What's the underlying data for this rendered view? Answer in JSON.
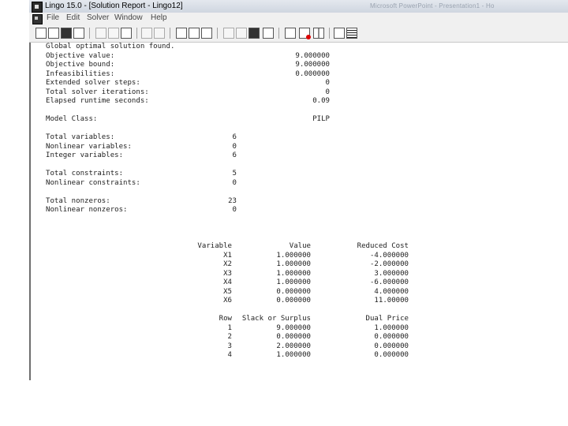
{
  "window": {
    "title": "Lingo 15.0 - [Solution Report - Lingo12]",
    "background_app": "Microsoft PowerPoint - Presentation1 - Ho"
  },
  "menu": [
    "File",
    "Edit",
    "Solver",
    "Window",
    "Help"
  ],
  "toolbar_icons": [
    "new-icon",
    "open-icon",
    "save-icon",
    "print-icon",
    "cut-icon",
    "copy-icon",
    "paste-icon",
    "undo-icon",
    "redo-icon",
    "find-icon",
    "goto-line-icon",
    "match-paren-icon",
    "solve-icon",
    "solution-icon",
    "matrix-picture-icon",
    "options-icon",
    "send-to-back-icon",
    "close-all-icon",
    "tile-icon",
    "help-icon",
    "context-help-icon"
  ],
  "report": {
    "header": "Global optimal solution found.",
    "summary": [
      {
        "label": "Objective value:",
        "value": "9.000000"
      },
      {
        "label": "Objective bound:",
        "value": "9.000000"
      },
      {
        "label": "Infeasibilities:",
        "value": "0.000000"
      },
      {
        "label": "Extended solver steps:",
        "value": "0"
      },
      {
        "label": "Total solver iterations:",
        "value": "0"
      },
      {
        "label": "Elapsed runtime seconds:",
        "value": "0.09"
      }
    ],
    "model_class": {
      "label": "Model Class:",
      "value": "PILP"
    },
    "variables": [
      {
        "label": "Total variables:",
        "value": "6"
      },
      {
        "label": "Nonlinear variables:",
        "value": "0"
      },
      {
        "label": "Integer variables:",
        "value": "6"
      }
    ],
    "constraints": [
      {
        "label": "Total constraints:",
        "value": "5"
      },
      {
        "label": "Nonlinear constraints:",
        "value": "0"
      }
    ],
    "nonzeros": [
      {
        "label": "Total nonzeros:",
        "value": "23"
      },
      {
        "label": "Nonlinear nonzeros:",
        "value": "0"
      }
    ],
    "var_table": {
      "headers": [
        "Variable",
        "Value",
        "Reduced Cost"
      ],
      "rows": [
        [
          "X1",
          "1.000000",
          "-4.000000"
        ],
        [
          "X2",
          "1.000000",
          "-2.000000"
        ],
        [
          "X3",
          "1.000000",
          "3.000000"
        ],
        [
          "X4",
          "1.000000",
          "-6.000000"
        ],
        [
          "X5",
          "0.000000",
          "4.000000"
        ],
        [
          "X6",
          "0.000000",
          "11.00000"
        ]
      ]
    },
    "row_table": {
      "headers": [
        "Row",
        "Slack or Surplus",
        "Dual Price"
      ],
      "rows": [
        [
          "1",
          "9.000000",
          "1.000000"
        ],
        [
          "2",
          "0.000000",
          "0.000000"
        ],
        [
          "3",
          "2.000000",
          "0.000000"
        ],
        [
          "4",
          "1.000000",
          "0.000000"
        ]
      ]
    }
  }
}
